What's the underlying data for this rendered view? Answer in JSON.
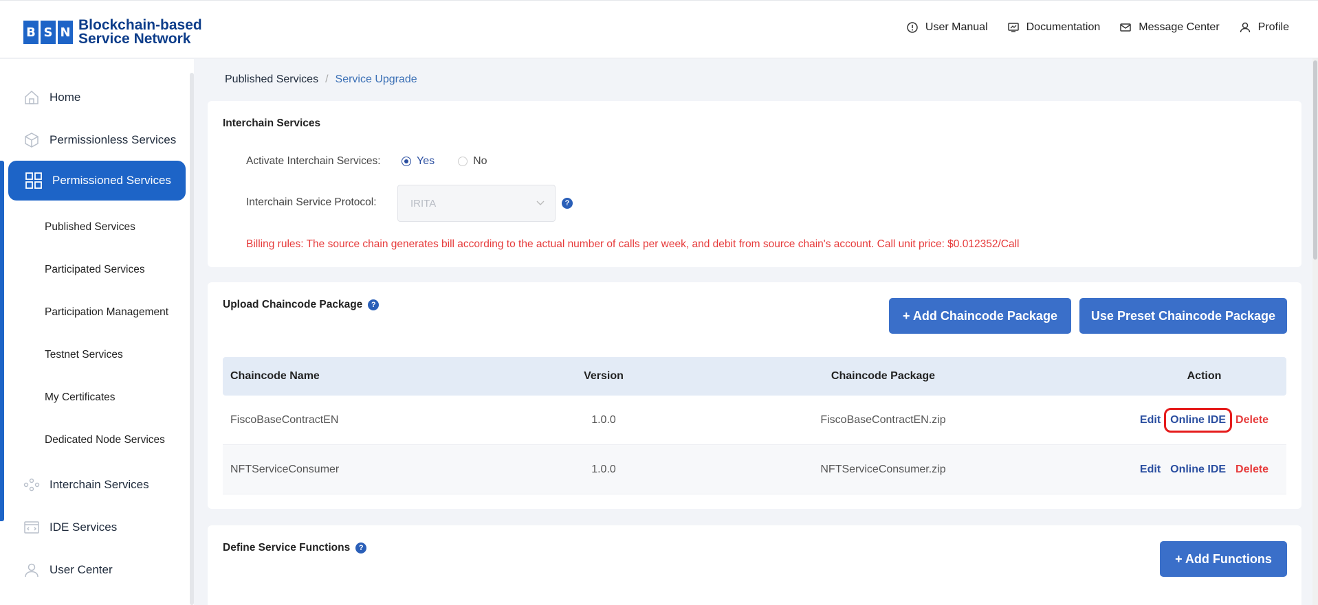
{
  "header": {
    "logo_letters": [
      "B",
      "S",
      "N"
    ],
    "logo_line1": "Blockchain-based",
    "logo_line2": "Service Network",
    "nav": [
      "User Manual",
      "Documentation",
      "Message Center",
      "Profile"
    ]
  },
  "sidebar": {
    "home": "Home",
    "permissionless": "Permissionless Services",
    "permissioned": "Permissioned Services",
    "sub_items": [
      "Published Services",
      "Participated Services",
      "Participation Management",
      "Testnet Services",
      "My Certificates",
      "Dedicated Node Services"
    ],
    "interchain": "Interchain Services",
    "ide": "IDE Services",
    "user_center": "User Center"
  },
  "breadcrumb": {
    "parent": "Published Services",
    "separator": "/",
    "current": "Service Upgrade"
  },
  "interchain": {
    "title": "Interchain Services",
    "activate_label": "Activate Interchain Services:",
    "yes": "Yes",
    "no": "No",
    "selected": "Yes",
    "protocol_label": "Interchain Service Protocol:",
    "protocol_value": "IRITA",
    "billing": "Billing rules: The source chain generates bill according to the actual number of calls per week, and debit from source chain's account. Call unit price: $0.012352/Call"
  },
  "chaincode": {
    "title": "Upload Chaincode Package",
    "add_button": "+ Add Chaincode Package",
    "preset_button": "Use Preset Chaincode Package",
    "columns": [
      "Chaincode Name",
      "Version",
      "Chaincode Package",
      "Action"
    ],
    "rows": [
      {
        "name": "FiscoBaseContractEN",
        "version": "1.0.0",
        "package": "FiscoBaseContractEN.zip"
      },
      {
        "name": "NFTServiceConsumer",
        "version": "1.0.0",
        "package": "NFTServiceConsumer.zip"
      }
    ],
    "action_edit": "Edit",
    "action_ide": "Online IDE",
    "action_delete": "Delete"
  },
  "functions": {
    "title": "Define Service Functions",
    "add_button": "+ Add Functions"
  },
  "colors": {
    "primary": "#1d64c7",
    "button": "#3a6fc9",
    "danger": "#e63a3a",
    "highlight": "#e51c1c"
  }
}
